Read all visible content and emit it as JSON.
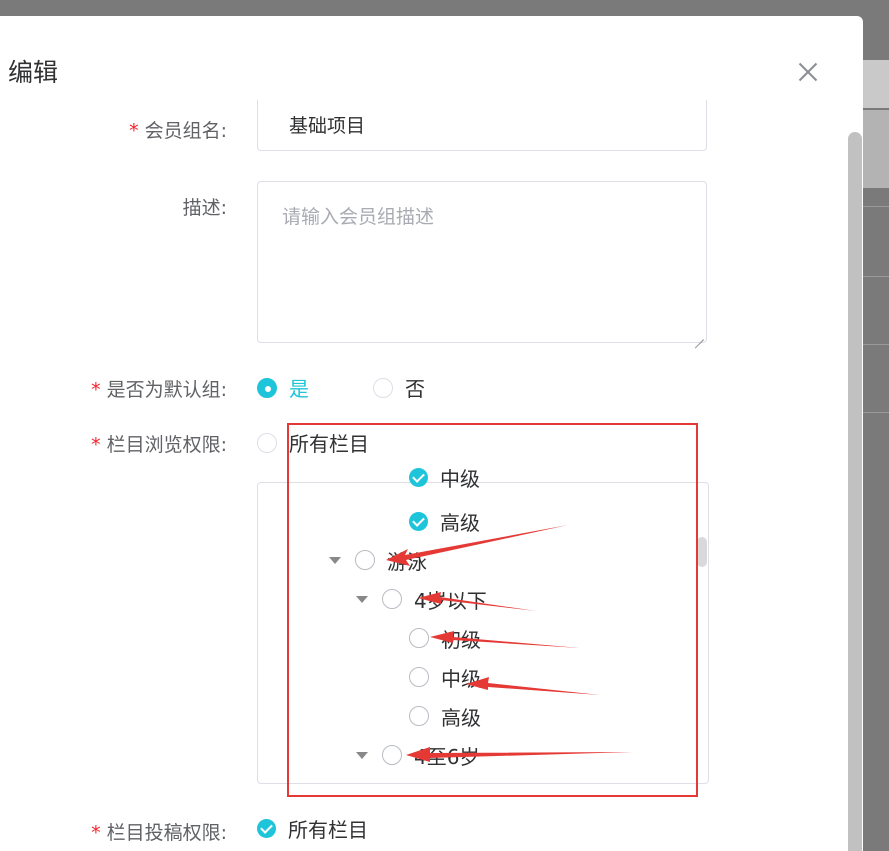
{
  "dialog": {
    "title": "编辑",
    "close_label": "×"
  },
  "form": {
    "name": {
      "label": "会员组名:",
      "value": "基础项目",
      "required": true
    },
    "description": {
      "label": "描述:",
      "placeholder": "请输入会员组描述"
    },
    "is_default": {
      "label": "是否为默认组:",
      "required": true,
      "options": [
        "是",
        "否"
      ],
      "selected": "是"
    },
    "browse_permission": {
      "label": "栏目浏览权限:",
      "required": true,
      "all_label": "所有栏目",
      "all_checked": false
    },
    "submit_permission": {
      "label": "栏目投稿权限:",
      "required": true,
      "all_label": "所有栏目",
      "all_checked": true
    }
  },
  "tree": {
    "nodes": [
      {
        "label": "中级",
        "checked": true
      },
      {
        "label": "高级",
        "checked": true
      },
      {
        "label": "游泳",
        "checked": false,
        "expanded": true
      },
      {
        "label": "4岁以下",
        "checked": false,
        "expanded": true
      },
      {
        "label": "初级",
        "checked": false
      },
      {
        "label": "中级",
        "checked": false
      },
      {
        "label": "高级",
        "checked": false
      },
      {
        "label": "4至6岁",
        "checked": false,
        "expanded": true
      }
    ]
  },
  "colors": {
    "accent": "#1ec4d9",
    "required_star": "#f5222d",
    "annotation_red": "#e53935"
  },
  "required_mark": "*"
}
